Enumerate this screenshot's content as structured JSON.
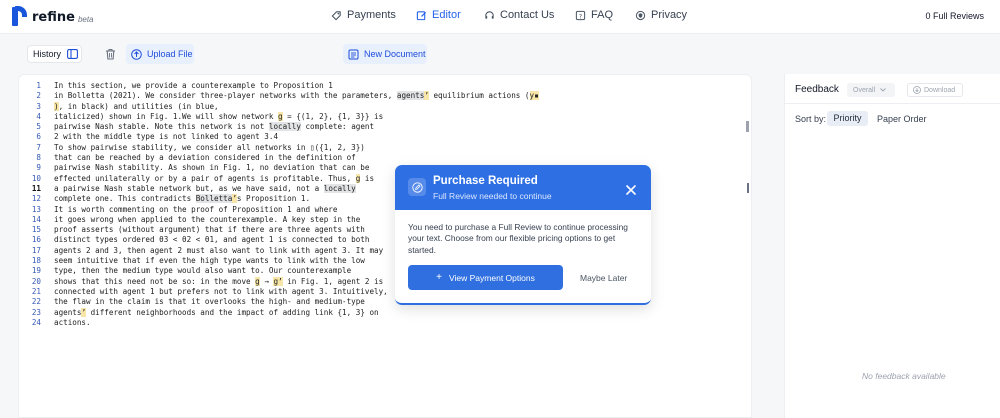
{
  "brand": {
    "name": "refine",
    "tag": "beta",
    "color": "#1a56db"
  },
  "nav": [
    {
      "label": "Payments",
      "icon": "tag-icon"
    },
    {
      "label": "Editor",
      "icon": "edit-icon",
      "active": true
    },
    {
      "label": "Contact Us",
      "icon": "headset-icon"
    },
    {
      "label": "FAQ",
      "icon": "question-icon"
    },
    {
      "label": "Privacy",
      "icon": "shield-icon"
    }
  ],
  "reviews_count": "0 Full Reviews",
  "toolbar": {
    "history_label": "History",
    "upload_label": "Upload File",
    "new_doc_label": "New Document"
  },
  "editor": {
    "current_line": 11,
    "lines": [
      [
        {
          "t": "In this section, we provide a counterexample to Proposition 1"
        }
      ],
      [
        {
          "t": "in Bolletta (2021). We consider three-player networks with the parameters, "
        },
        {
          "t": "agents",
          "h": "g"
        },
        {
          "t": "’",
          "h": "y"
        },
        {
          "t": " equilibrium actions ("
        },
        {
          "t": "y▪",
          "h": "y"
        }
      ],
      [
        {
          "t": ")",
          "h": "y"
        },
        {
          "t": ", in black) and utilities (in blue,"
        }
      ],
      [
        {
          "t": "italicized) shown in Fig. 1.We will show network "
        },
        {
          "t": "g",
          "h": "y"
        },
        {
          "t": " = {(1, 2}, {1, 3}} is"
        }
      ],
      [
        {
          "t": "pairwise Nash stable. Note this network is not "
        },
        {
          "t": "locally",
          "h": "g"
        },
        {
          "t": " complete: agent"
        }
      ],
      [
        {
          "t": "2 with the middle type is not linked to agent 3.4"
        }
      ],
      [
        {
          "t": "To show pairwise stability, we consider all networks in ▯({1, 2, 3})"
        }
      ],
      [
        {
          "t": "that can be reached by a deviation considered in the definition of"
        }
      ],
      [
        {
          "t": "pairwise Nash stability. As shown in Fig. 1, no deviation that can be"
        }
      ],
      [
        {
          "t": "effected unilaterally or by a pair of agents is profitable. Thus, "
        },
        {
          "t": "g",
          "h": "y"
        },
        {
          "t": " is"
        }
      ],
      [
        {
          "t": "a pairwise Nash stable network but, as we have said, not a "
        },
        {
          "t": "locally",
          "h": "g"
        }
      ],
      [
        {
          "t": "complete one. This contradicts "
        },
        {
          "t": "Bolletta",
          "h": "g"
        },
        {
          "t": "’",
          "h": "y"
        },
        {
          "t": "s Proposition 1."
        }
      ],
      [
        {
          "t": "It is worth commenting on the proof of Proposition 1 and where"
        }
      ],
      [
        {
          "t": "it goes wrong when applied to the counterexample. A key step in the"
        }
      ],
      [
        {
          "t": "proof asserts (without argument) that if there are three agents with"
        }
      ],
      [
        {
          "t": "distinct types ordered θ3 < θ2 < θ1, and agent 1 is connected to both"
        }
      ],
      [
        {
          "t": "agents 2 and 3, then agent 2 must also want to link with agent 3. It may"
        }
      ],
      [
        {
          "t": "seem intuitive that if even the high type wants to link with the low"
        }
      ],
      [
        {
          "t": "type, then the medium type would also want to. Our counterexample"
        }
      ],
      [
        {
          "t": "shows that this need not be so: in the move "
        },
        {
          "t": "g",
          "h": "y"
        },
        {
          "t": " → "
        },
        {
          "t": "g",
          "h": "y"
        },
        {
          "t": "’",
          "h": "y"
        },
        {
          "t": " in Fig. 1, agent 2 is"
        }
      ],
      [
        {
          "t": "connected with agent 1 but prefers not to link with agent 3. Intuitively,"
        }
      ],
      [
        {
          "t": "the flaw in the claim is that it overlooks the high- and medium-type"
        }
      ],
      [
        {
          "t": "agents"
        },
        {
          "t": "’",
          "h": "y"
        },
        {
          "t": " different neighborhoods and the impact of adding link {1, 3} on"
        }
      ],
      [
        {
          "t": "actions."
        }
      ]
    ]
  },
  "feedback": {
    "title": "Feedback",
    "filter_value": "Overall",
    "download_label": "Download",
    "sort_label": "Sort by:",
    "sort_options": [
      "Priority",
      "Paper Order"
    ],
    "sort_selected": "Priority",
    "empty_text": "No feedback available"
  },
  "modal": {
    "title": "Purchase Required",
    "subtitle": "Full Review needed to continue",
    "body": "You need to purchase a Full Review to continue processing your text. Choose from our flexible pricing options to get started.",
    "primary_label": "View Payment Options",
    "secondary_label": "Maybe Later",
    "accent": "#2e6fe4"
  }
}
